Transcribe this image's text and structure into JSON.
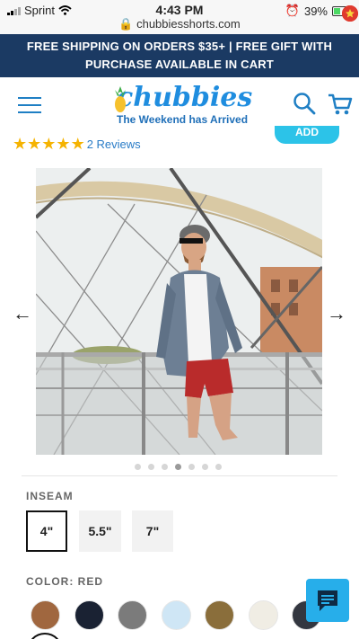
{
  "status_bar": {
    "carrier": "Sprint",
    "time": "4:43 PM",
    "url": "chubbiesshorts.com",
    "battery": "39%",
    "battery_level": 0.39
  },
  "promo_banner": {
    "line1": "FREE SHIPPING ON ORDERS $35+ | FREE GIFT WITH",
    "line2": "PURCHASE AVAILABLE IN CART"
  },
  "header": {
    "logo_name": "chubbies",
    "logo_tagline": "The Weekend has Arrived",
    "cart_badge_icon": "star-icon"
  },
  "product": {
    "rating_stars": 5,
    "reviews_label": "2 Reviews",
    "add_button_label": "ADD",
    "image_alt": "Man walking on bridge wearing red shorts",
    "carousel_dots": 7,
    "carousel_active": 3
  },
  "inseam": {
    "label": "INSEAM",
    "options": [
      "4\"",
      "5.5\"",
      "7\""
    ],
    "selected": "4\""
  },
  "color": {
    "label": "COLOR: RED",
    "swatches": [
      "#a0673f",
      "#1a2233",
      "#7b7b7b",
      "#cfe6f5",
      "#8a6e3b",
      "#f0ede4",
      "#333740"
    ]
  },
  "icons": {
    "menu": "hamburger-menu-icon",
    "search": "search-icon",
    "cart": "cart-icon",
    "prev": "arrow-left-icon",
    "next": "arrow-right-icon",
    "chat": "chat-icon"
  },
  "colors": {
    "banner_bg": "#1b3a63",
    "brand_blue": "#1f8ddf",
    "star_yellow": "#f5b301",
    "add_cyan": "#2cc3e8",
    "chat_blue": "#27aeea"
  }
}
